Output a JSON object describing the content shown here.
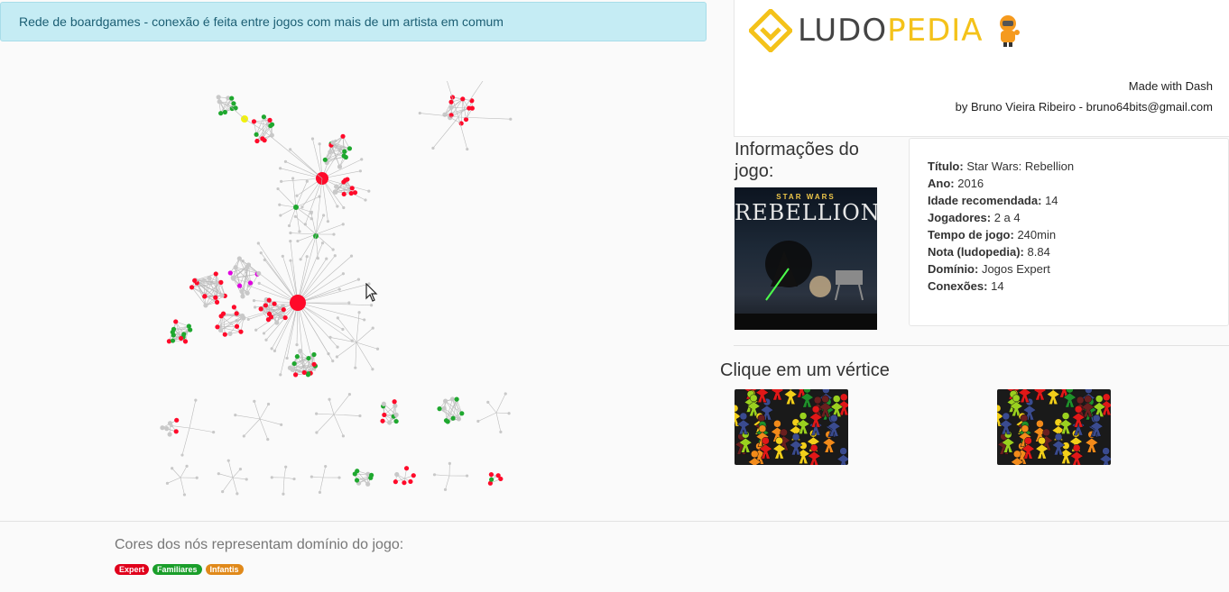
{
  "banner": {
    "text": "Rede de boardgames - conexão é feita entre jogos com mais de um artista em comum"
  },
  "header": {
    "logo_part1": "LUDO",
    "logo_part2": "PEDIA",
    "made_line1": "Made with Dash",
    "made_line2": "by Bruno Vieira Ribeiro - bruno64bits@gmail.com"
  },
  "info": {
    "heading": "Informações do jogo:",
    "poster_top": "STAR WARS",
    "poster_title": "REBELLION",
    "fields": [
      {
        "label": "Título:",
        "value": "Star Wars: Rebellion"
      },
      {
        "label": "Ano:",
        "value": "2016"
      },
      {
        "label": "Idade recomendada:",
        "value": "14"
      },
      {
        "label": "Jogadores:",
        "value": "2 a 4"
      },
      {
        "label": "Tempo de jogo:",
        "value": "240min"
      },
      {
        "label": "Nota (ludopedia):",
        "value": "8.84"
      },
      {
        "label": "Domínio:",
        "value": "Jogos Expert"
      },
      {
        "label": "Conexões:",
        "value": "14"
      }
    ]
  },
  "click": {
    "heading": "Clique em um vértice"
  },
  "footer": {
    "legend_title": "Cores dos nós representam domínio do jogo:",
    "badges": [
      {
        "label": "Expert",
        "color": "#e0001b"
      },
      {
        "label": "Familiares",
        "color": "#1a9e2a"
      },
      {
        "label": "Infantis",
        "color": "#e0891a"
      }
    ]
  },
  "colors": {
    "expert": "#ff0a2a",
    "familiar": "#1fa82f",
    "none": "#c8c8c8",
    "magenta": "#e000e0",
    "yellow": "#f2f20a"
  }
}
